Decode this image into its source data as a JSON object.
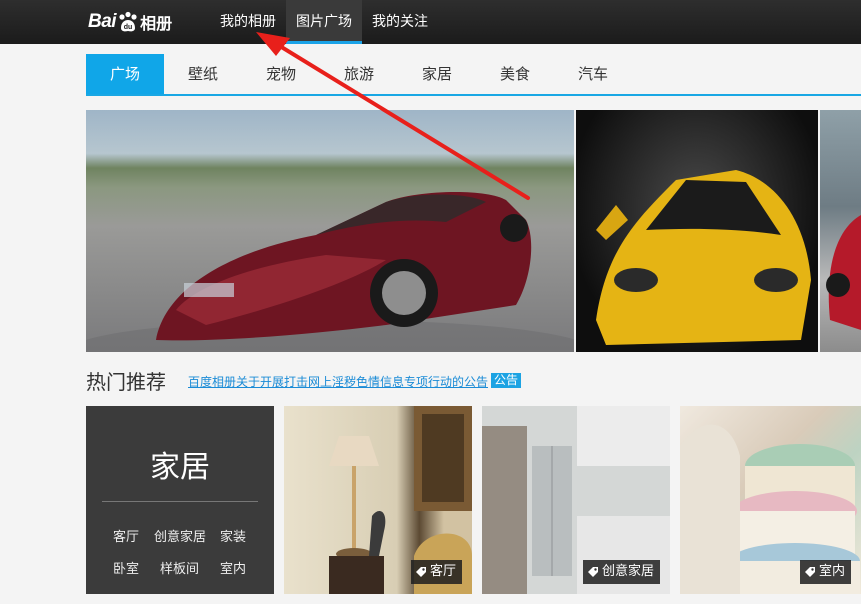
{
  "header": {
    "logo_text": "Bai",
    "logo_suffix": "相册",
    "nav": [
      {
        "label": "我的相册",
        "active": false
      },
      {
        "label": "图片广场",
        "active": true
      },
      {
        "label": "我的关注",
        "active": false
      }
    ]
  },
  "categories": [
    {
      "label": "广场",
      "active": true
    },
    {
      "label": "壁纸"
    },
    {
      "label": "宠物"
    },
    {
      "label": "旅游"
    },
    {
      "label": "家居"
    },
    {
      "label": "美食"
    },
    {
      "label": "汽车"
    }
  ],
  "hot": {
    "title": "热门推荐",
    "notice_link": "百度相册关于开展打击网上淫秽色情信息专项行动的公告",
    "notice_badge": "公告"
  },
  "home_tile": {
    "title": "家居",
    "links": [
      "客厅",
      "创意家居",
      "家装",
      "卧室",
      "样板间",
      "室内"
    ]
  },
  "photo_tiles": [
    {
      "tag": "客厅"
    },
    {
      "tag": "创意家居"
    },
    {
      "tag": "室内"
    }
  ],
  "colors": {
    "accent": "#10a6e8",
    "annotation_arrow": "#e8201b"
  }
}
